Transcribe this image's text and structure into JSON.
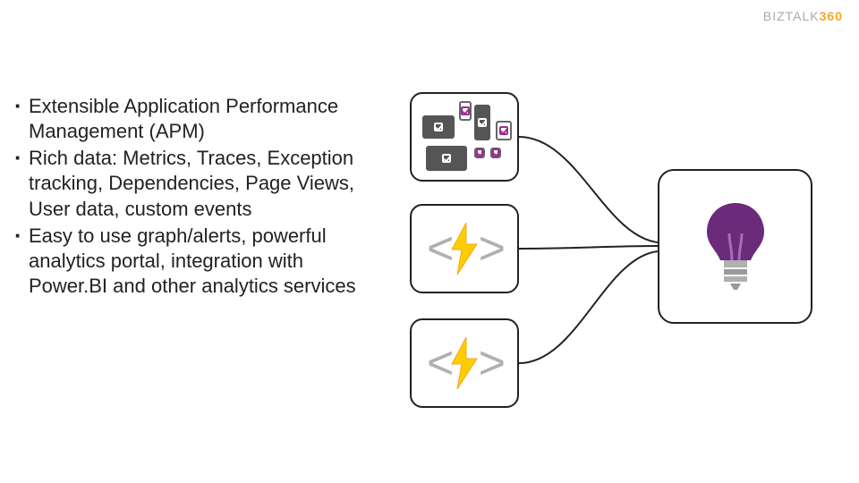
{
  "logo": {
    "brand_left": "BIZTALK",
    "brand_right": "360"
  },
  "bullets": [
    "Extensible Application Performance Management (APM)",
    "Rich data: Metrics, Traces, Exception tracking, Dependencies, Page Views, User data, custom events",
    "Easy to use graph/alerts, powerful analytics portal, integration with Power.BI and other analytics services"
  ],
  "icons": {
    "devices": "multi-device-check",
    "fn": "code-lightning",
    "insight": "lightbulb"
  },
  "colors": {
    "accent_purple": "#6b2a7a",
    "accent_magenta": "#9b2e8f",
    "bolt_yellow": "#ffcc00",
    "bolt_shadow": "#f5a623",
    "grey": "#b0b0b0"
  }
}
